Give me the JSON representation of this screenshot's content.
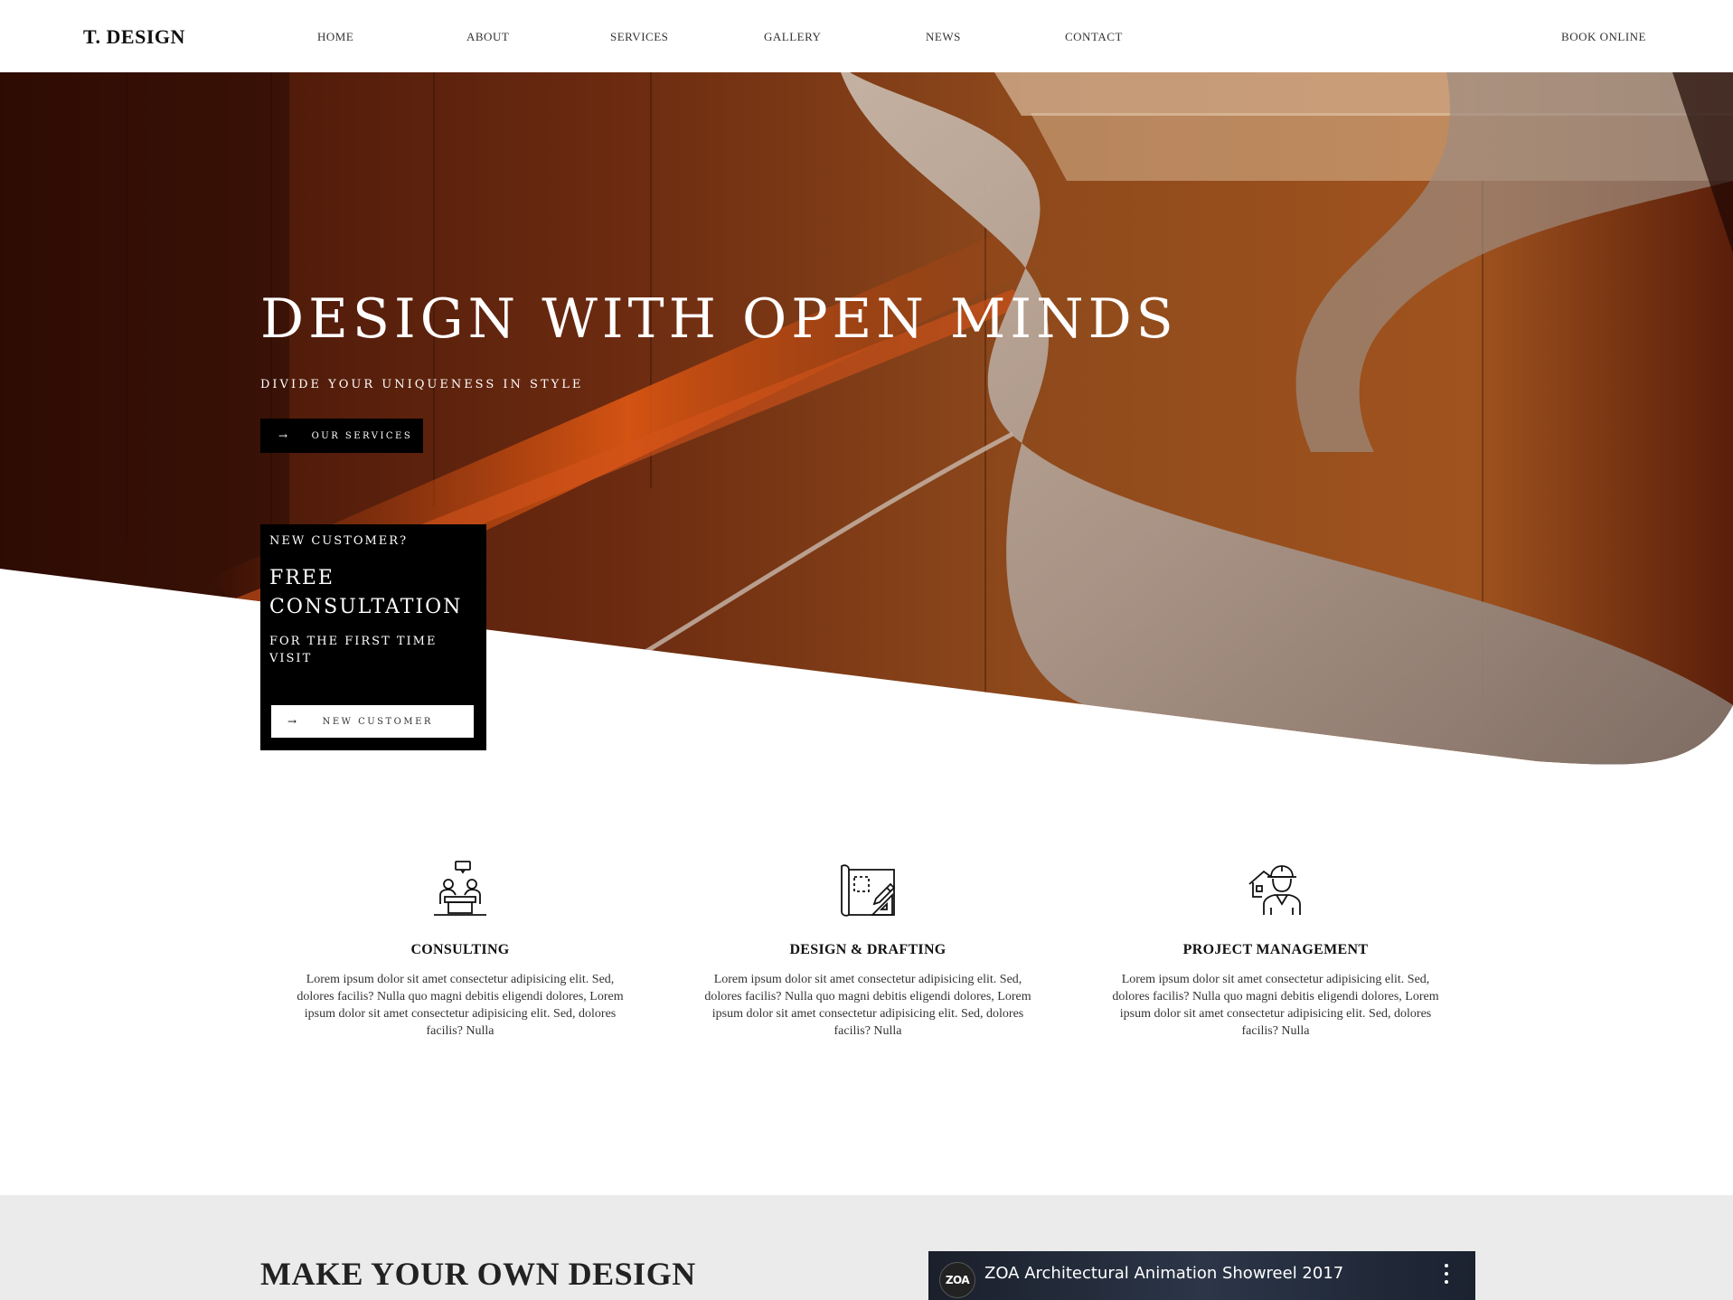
{
  "brand": {
    "logo": "T. DESIGN"
  },
  "nav": {
    "items": [
      "HOME",
      "ABOUT",
      "SERVICES",
      "GALLERY",
      "NEWS",
      "CONTACT"
    ],
    "book": "BOOK ONLINE"
  },
  "hero": {
    "title": "DESIGN WITH OPEN MINDS",
    "subtitle": "DIVIDE YOUR UNIQUENESS IN STYLE",
    "button_arrow": "→",
    "button_label": "OUR SERVICES"
  },
  "customer_card": {
    "eyebrow": "NEW CUSTOMER?",
    "title": "FREE CONSULTATION",
    "subtitle": "FOR THE FIRST TIME VISIT",
    "button_arrow": "→",
    "button_label": "NEW CUSTOMER"
  },
  "services": [
    {
      "icon": "consulting-icon",
      "title": "CONSULTING",
      "text": "Lorem ipsum dolor sit amet consectetur adipisicing elit. Sed, dolores facilis? Nulla quo magni debitis eligendi dolores, Lorem ipsum dolor sit amet consectetur adipisicing elit. Sed, dolores facilis? Nulla"
    },
    {
      "icon": "blueprint-icon",
      "title": "DESIGN & DRAFTING",
      "text": "Lorem ipsum dolor sit amet consectetur adipisicing elit. Sed, dolores facilis? Nulla quo magni debitis eligendi dolores, Lorem ipsum dolor sit amet consectetur adipisicing elit. Sed, dolores facilis? Nulla"
    },
    {
      "icon": "engineer-icon",
      "title": "PROJECT MANAGEMENT",
      "text": "Lorem ipsum dolor sit amet consectetur adipisicing elit. Sed, dolores facilis? Nulla quo magni debitis eligendi dolores, Lorem ipsum dolor sit amet consectetur adipisicing elit. Sed, dolores facilis? Nulla"
    }
  ],
  "bottom": {
    "title": "MAKE YOUR OWN DESIGN",
    "video": {
      "channel": "ZOA",
      "title": "ZOA Architectural Animation Showreel 2017"
    }
  },
  "colors": {
    "accent_dark": "#000000",
    "hero_wood": "#8a3a14",
    "hero_shadow": "#2a0b04",
    "bottom_bg": "#ebebeb"
  }
}
